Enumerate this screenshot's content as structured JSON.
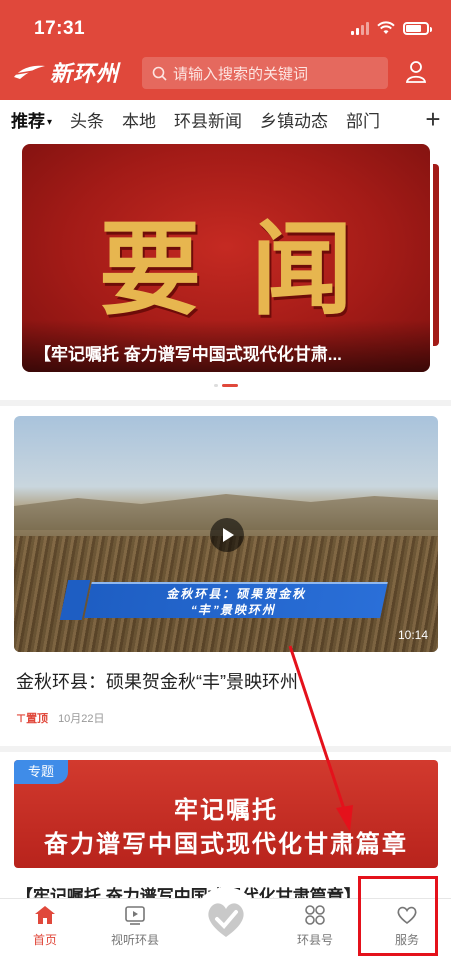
{
  "status_bar": {
    "time": "17:31"
  },
  "header": {
    "logo_text": "新环州",
    "search_placeholder": "请输入搜索的关键词"
  },
  "tabs": {
    "items": [
      "推荐",
      "头条",
      "本地",
      "环县新闻",
      "乡镇动态",
      "部门"
    ],
    "active": "推荐"
  },
  "banner": {
    "title": "要闻",
    "caption": "【牢记嘱托 奋力谱写中国式现代化甘肃..."
  },
  "news": {
    "video_overlay_line1": "金秋环县：硕果贺金秋",
    "video_overlay_line2": "“丰”景映环州",
    "duration": "10:14",
    "title": "金秋环县：硕果贺金秋“丰”景映环州",
    "pin_label": "置顶",
    "date": "10月22日"
  },
  "topic": {
    "badge": "专题",
    "line1": "牢记嘱托",
    "line2": "奋力谱写中国式现代化甘肃篇章",
    "caption": "【牢记嘱托 奋力谱写中国式现代化甘肃篇章】"
  },
  "tabbar": {
    "home": "首页",
    "video": "视听环县",
    "account": "环县号",
    "service": "服务"
  },
  "colors": {
    "brand_red": "#e0483b",
    "annotation_red": "#e4111b"
  }
}
